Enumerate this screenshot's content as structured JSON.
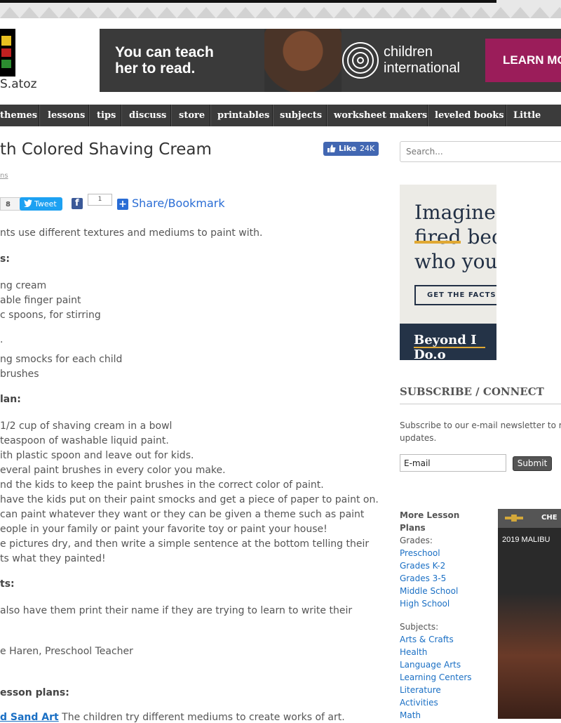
{
  "logo": {
    "text": "S.atoz"
  },
  "ad_banner": {
    "headline_line1": "You can teach",
    "headline_line2": "her to read.",
    "brand_line1": "children",
    "brand_line2": "international",
    "cta": "LEARN MO"
  },
  "nav": [
    "themes",
    "lessons",
    "tips",
    "discuss",
    "store",
    "printables",
    "subjects",
    "worksheet makers",
    "leveled books",
    "Little Gira"
  ],
  "article": {
    "title": "th Colored Shaving Cream",
    "like_label": "Like",
    "like_count": "24K",
    "breadcrumb": "ns",
    "share_count": "8",
    "tweet_label": "Tweet",
    "fb_count": "1",
    "share_label": "Share/Bookmark",
    "lines": [
      "nts use different textures and mediums to paint with.",
      "s:",
      "ng cream",
      "able finger paint",
      "c spoons, for stirring",
      ".",
      "ng smocks for each child",
      "brushes",
      "lan:",
      "1/2 cup of shaving cream in a bowl",
      " teaspoon of washable liquid paint.",
      "ith plastic spoon and leave out for kids.",
      "everal paint brushes in every color you make.",
      "nd the kids to keep the paint brushes in the correct color of paint.",
      "have the kids put on their paint smocks and get a piece of paper to paint on.",
      "can paint whatever they want or they can be given a theme such as paint",
      "eople in your family or paint your favorite toy or paint your house!",
      "e pictures dry, and then write a simple sentence at the bottom telling their",
      "ts what they painted!",
      "ts:",
      "also have them print their name if they are trying to learn to write their",
      "e Haren, Preschool Teacher",
      "esson plans:"
    ],
    "related_link": "d Sand Art",
    "related_text": " The children try different mediums to create works of art."
  },
  "sidebar": {
    "search_placeholder": "Search...",
    "side_ad": {
      "line1": "Imagine",
      "line2": "fired bec",
      "line3": "who you",
      "cta": "GET THE FACTS",
      "brand": "Beyond I Do.o"
    },
    "subscribe_heading": "SUBSCRIBE / CONNECT",
    "subscribe_line1": "Subscribe to our e-mail newsletter to r",
    "subscribe_line2": "updates.",
    "email_value": "E-mail",
    "submit_label": "Submit",
    "more_heading_1": "More Lesson",
    "more_heading_2": "Plans",
    "grades_label": "Grades:",
    "grades": [
      "Preschool",
      "Grades K-2",
      "Grades 3-5",
      "Middle School",
      "High School"
    ],
    "subjects_label": "Subjects:",
    "subjects": [
      "Arts & Crafts",
      "Health",
      "Language Arts",
      "Learning Centers",
      "Literature",
      "Activities",
      "Math"
    ]
  },
  "car_ad": {
    "brand": "CHE",
    "model": "2019 MALIBU"
  },
  "colors": {
    "nav_bg": "#3b3b3b",
    "link": "#1a6fc4",
    "accent": "#9b1d5a"
  }
}
